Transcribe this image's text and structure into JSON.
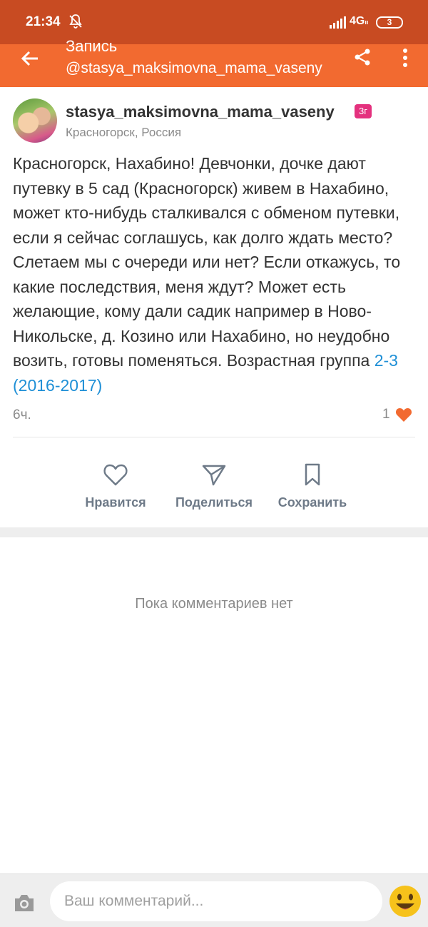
{
  "status": {
    "time": "21:34",
    "network": "4G",
    "network_sub": "ıı",
    "battery": "3"
  },
  "header": {
    "title": "Запись",
    "subtitle": "@stasya_maksimovna_mama_vaseny"
  },
  "post": {
    "author": "stasya_maksimovna_mama_vaseny",
    "age_badge": "3г",
    "location": "Красногорск, Россия",
    "text": "Красногорск, Нахабино! Девчонки, дочке дают путевку в 5 сад (Красногорск) живем в Нахабино, может кто-нибудь сталкивался с обменом путевки, если я сейчас соглашусь, как долго ждать место? Слетаем мы с очереди или нет? Если откажусь, то какие последствия, меня ждут? Может есть желающие, кому дали садик например в Ново-Никольске, д. Козино или Нахабино, но неудобно возить, готовы поменяться. Возрастная группа ",
    "tag": "2-3 (2016-2017)",
    "time_ago": "6ч.",
    "likes": "1"
  },
  "actions": {
    "like": "Нравится",
    "share": "Поделиться",
    "save": "Сохранить"
  },
  "comments": {
    "empty": "Пока комментариев нет",
    "placeholder": "Ваш комментарий..."
  },
  "colors": {
    "status_bar": "#c84b22",
    "app_bar": "#f26a30",
    "link": "#1e8fd6",
    "heart": "#f26a30",
    "badge": "#e4317e"
  },
  "icons": [
    "back-arrow-icon",
    "share-icon",
    "more-vert-icon",
    "heart-icon",
    "send-icon",
    "bookmark-icon",
    "camera-icon",
    "emoji-icon"
  ]
}
